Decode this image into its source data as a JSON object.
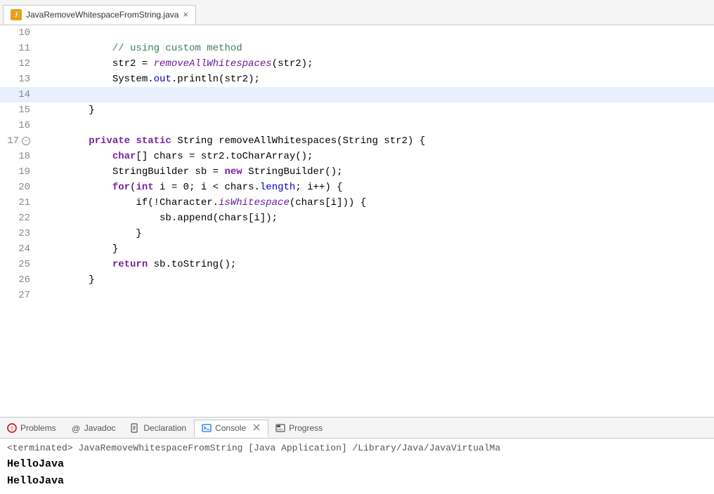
{
  "tab": {
    "filename": "JavaRemoveWhitespaceFromString.java",
    "close_icon": "×",
    "icon_label": "J"
  },
  "code": {
    "lines": [
      {
        "num": "10",
        "fold": false,
        "highlight": false,
        "tokens": []
      },
      {
        "num": "11",
        "fold": false,
        "highlight": false,
        "tokens": [
          {
            "type": "cm",
            "text": "            // using custom method"
          }
        ]
      },
      {
        "num": "12",
        "fold": false,
        "highlight": false,
        "tokens": [
          {
            "type": "id",
            "text": "            str2 = "
          },
          {
            "type": "it",
            "text": "removeAllWhitespaces"
          },
          {
            "type": "id",
            "text": "(str2);"
          }
        ]
      },
      {
        "num": "13",
        "fold": false,
        "highlight": false,
        "tokens": [
          {
            "type": "id",
            "text": "            System."
          },
          {
            "type": "fi",
            "text": "out"
          },
          {
            "type": "id",
            "text": ".println(str2);"
          }
        ]
      },
      {
        "num": "14",
        "fold": false,
        "highlight": true,
        "tokens": []
      },
      {
        "num": "15",
        "fold": false,
        "highlight": false,
        "tokens": [
          {
            "type": "id",
            "text": "        }"
          }
        ]
      },
      {
        "num": "16",
        "fold": false,
        "highlight": false,
        "tokens": []
      },
      {
        "num": "17",
        "fold": true,
        "highlight": false,
        "tokens": [
          {
            "type": "kw",
            "text": "        private static"
          },
          {
            "type": "id",
            "text": " String "
          },
          {
            "type": "id",
            "text": "removeAllWhitespaces(String str2) {"
          }
        ]
      },
      {
        "num": "18",
        "fold": false,
        "highlight": false,
        "tokens": [
          {
            "type": "kw",
            "text": "            char"
          },
          {
            "type": "id",
            "text": "[] chars = str2.toCharArray();"
          }
        ]
      },
      {
        "num": "19",
        "fold": false,
        "highlight": false,
        "tokens": [
          {
            "type": "id",
            "text": "            StringBuilder sb = "
          },
          {
            "type": "kw",
            "text": "new"
          },
          {
            "type": "id",
            "text": " StringBuilder();"
          }
        ]
      },
      {
        "num": "20",
        "fold": false,
        "highlight": false,
        "tokens": [
          {
            "type": "kw",
            "text": "            for"
          },
          {
            "type": "id",
            "text": "("
          },
          {
            "type": "kw",
            "text": "int"
          },
          {
            "type": "id",
            "text": " i = 0; i < chars."
          },
          {
            "type": "fi",
            "text": "length"
          },
          {
            "type": "id",
            "text": "; i++) {"
          }
        ]
      },
      {
        "num": "21",
        "fold": false,
        "highlight": false,
        "tokens": [
          {
            "type": "id",
            "text": "                if(!Character."
          },
          {
            "type": "it",
            "text": "isWhitespace"
          },
          {
            "type": "id",
            "text": "(chars[i])) {"
          }
        ]
      },
      {
        "num": "22",
        "fold": false,
        "highlight": false,
        "tokens": [
          {
            "type": "id",
            "text": "                    sb.append(chars[i]);"
          }
        ]
      },
      {
        "num": "23",
        "fold": false,
        "highlight": false,
        "tokens": [
          {
            "type": "id",
            "text": "                }"
          }
        ]
      },
      {
        "num": "24",
        "fold": false,
        "highlight": false,
        "tokens": [
          {
            "type": "id",
            "text": "            }"
          }
        ]
      },
      {
        "num": "25",
        "fold": false,
        "highlight": false,
        "tokens": [
          {
            "type": "kw",
            "text": "            return"
          },
          {
            "type": "id",
            "text": " sb.toString();"
          }
        ]
      },
      {
        "num": "26",
        "fold": false,
        "highlight": false,
        "tokens": [
          {
            "type": "id",
            "text": "        }"
          }
        ]
      },
      {
        "num": "27",
        "fold": false,
        "highlight": false,
        "tokens": []
      }
    ]
  },
  "bottom_tabs": [
    {
      "id": "problems",
      "label": "Problems",
      "icon_type": "warning",
      "active": false
    },
    {
      "id": "javadoc",
      "label": "Javadoc",
      "icon_type": "at",
      "active": false
    },
    {
      "id": "declaration",
      "label": "Declaration",
      "icon_type": "doc",
      "active": false
    },
    {
      "id": "console",
      "label": "Console",
      "icon_type": "console",
      "active": true
    },
    {
      "id": "progress",
      "label": "Progress",
      "icon_type": "progress",
      "active": false
    }
  ],
  "console": {
    "status_text": "<terminated> JavaRemoveWhitespaceFromString [Java Application] /Library/Java/JavaVirtualMa",
    "output_lines": [
      "HelloJava",
      "HelloJava"
    ]
  }
}
